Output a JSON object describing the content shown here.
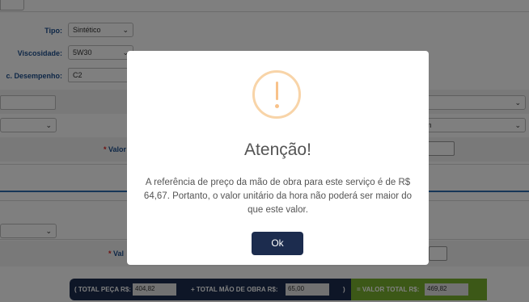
{
  "form": {
    "tipo_label": "Tipo:",
    "tipo_value": "Sintético",
    "viscosidade_label": "Viscosidade:",
    "viscosidade_value": "5W30",
    "desempenho_label": "c. Desempenho:",
    "desempenho_value": "C2",
    "valor_label_1": "Valor",
    "valor_label_2": "Val",
    "right_select_2_value": "m",
    "required_marker": "*"
  },
  "totals": {
    "peca_label": "( TOTAL PEÇA R$:",
    "peca_value": "404,82",
    "mao_label": "+ TOTAL MÃO DE OBRA R$:",
    "mao_value": "65,00",
    "close_paren": ")",
    "total_label": "= VALOR TOTAL R$:",
    "total_value": "469,82"
  },
  "modal": {
    "title": "Atenção!",
    "message": "A referência de preço da mão de obra para este serviço é de R$ 64,67. Portanto, o valor unitário da hora não poderá ser maior do que este valor.",
    "ok_label": "Ok",
    "icon": "exclamation-icon"
  },
  "colors": {
    "label_blue": "#1d4f8e",
    "navy": "#1c2c4e",
    "green": "#79b12e",
    "warning_orange": "#f8c28a"
  }
}
